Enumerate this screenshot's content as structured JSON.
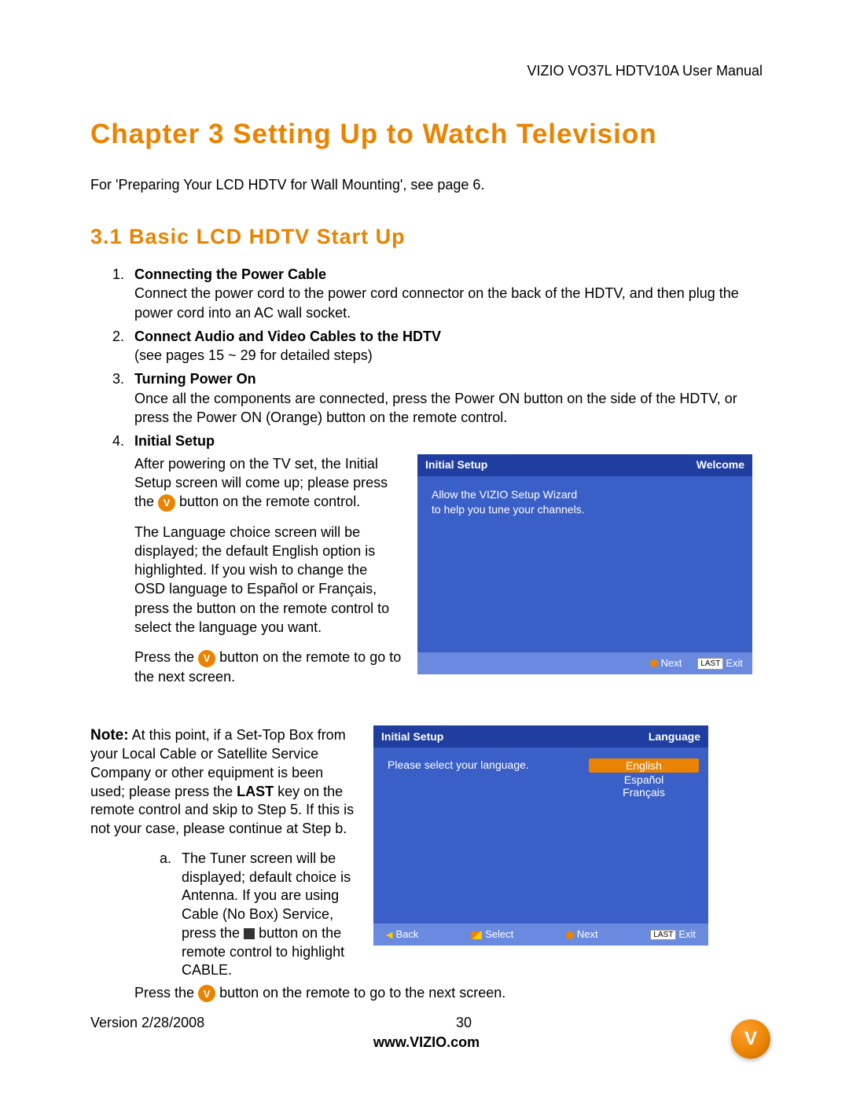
{
  "doc_header": "VIZIO VO37L HDTV10A User Manual",
  "chapter_title": "Chapter 3 Setting Up to Watch Television",
  "intro_text": "For 'Preparing Your LCD HDTV for Wall Mounting', see page 6.",
  "section_title": "3.1 Basic LCD HDTV Start Up",
  "steps": [
    {
      "title": "Connecting the Power Cable",
      "body": "Connect the power cord to the power cord connector on the back of the HDTV, and then plug the power cord into an AC wall socket."
    },
    {
      "title": "Connect Audio and Video Cables to the HDTV",
      "body": "(see pages 15 ~ 29 for detailed steps)"
    },
    {
      "title": "Turning Power On",
      "body": "Once all the components are connected, press the Power ON button on the side of the HDTV, or press the Power ON (Orange) button on the remote control."
    },
    {
      "title": "Initial Setup",
      "body": ""
    }
  ],
  "initial_setup": {
    "p1a": "After powering on the TV set, the Initial Setup screen will come up; please press the ",
    "p1b": " button on the remote control.",
    "p2": "The Language choice screen will be displayed; the default English option is highlighted.  If you wish to change the OSD language to Español or Français, press the      button on the remote control to select the language you want.",
    "p3a": "Press the ",
    "p3b": " button on the remote to go to the next screen."
  },
  "screen1": {
    "title": "Initial  Setup",
    "tag": "Welcome",
    "line1": "Allow the VIZIO Setup Wizard",
    "line2": "to help you tune your channels.",
    "next": "Next",
    "exit": "Exit",
    "lastbtn": "LAST"
  },
  "note": {
    "label": "Note:",
    "body_a": "  At this point, if a Set-Top Box from your Local Cable or Satellite Service Company or other equipment is been used; please press the ",
    "body_bold": "LAST",
    "body_b": " key on the remote control and skip to Step 5. If this is not your case, please continue at Step b."
  },
  "screen2": {
    "title": "Initial  Setup",
    "tag": "Language",
    "prompt": "Please select your language.",
    "langs": [
      "English",
      "Español",
      "Français"
    ],
    "back": "Back",
    "select": "Select",
    "next": "Next",
    "exit": "Exit",
    "lastbtn": "LAST"
  },
  "sub_a": {
    "text_a": "The Tuner screen will be displayed; default choice is Antenna.  If you are using Cable (No Box) Service, press the ",
    "text_b": " button on the remote control to highlight CABLE."
  },
  "press_line_a": "Press the ",
  "press_line_b": " button on the remote to go to the next screen.",
  "footer": {
    "version": "Version 2/28/2008",
    "page": "30",
    "url": "www.VIZIO.com"
  }
}
